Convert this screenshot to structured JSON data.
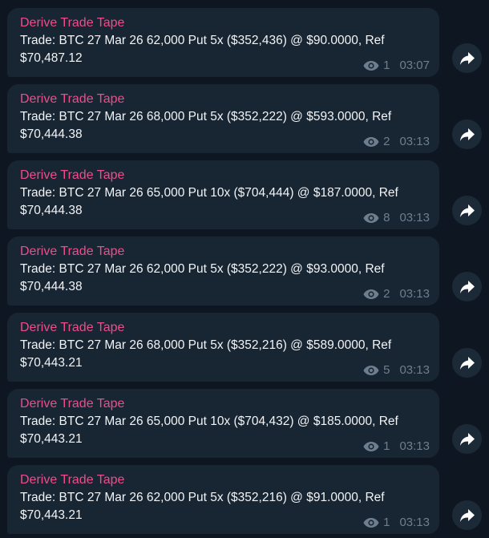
{
  "messages": [
    {
      "sender": "Derive Trade Tape",
      "text": "Trade: BTC 27 Mar 26 62,000 Put 5x ($352,436) @ $90.0000, Ref $70,487.12",
      "views": "1",
      "time": "03:07"
    },
    {
      "sender": "Derive Trade Tape",
      "text": "Trade: BTC 27 Mar 26 68,000 Put 5x ($352,222) @ $593.0000, Ref $70,444.38",
      "views": "2",
      "time": "03:13"
    },
    {
      "sender": "Derive Trade Tape",
      "text": "Trade: BTC 27 Mar 26 65,000 Put 10x ($704,444) @ $187.0000, Ref $70,444.38",
      "views": "8",
      "time": "03:13"
    },
    {
      "sender": "Derive Trade Tape",
      "text": "Trade: BTC 27 Mar 26 62,000 Put 5x ($352,222) @ $93.0000, Ref $70,444.38",
      "views": "2",
      "time": "03:13"
    },
    {
      "sender": "Derive Trade Tape",
      "text": "Trade: BTC 27 Mar 26 68,000 Put 5x ($352,216) @ $589.0000, Ref $70,443.21",
      "views": "5",
      "time": "03:13"
    },
    {
      "sender": "Derive Trade Tape",
      "text": "Trade: BTC 27 Mar 26 65,000 Put 10x ($704,432) @ $185.0000, Ref $70,443.21",
      "views": "1",
      "time": "03:13"
    },
    {
      "sender": "Derive Trade Tape",
      "text": "Trade: BTC 27 Mar 26 62,000 Put 5x ($352,216) @ $91.0000, Ref $70,443.21",
      "views": "1",
      "time": "03:13"
    }
  ],
  "icons": {
    "views": "eye-icon",
    "share": "share-arrow-icon"
  },
  "colors": {
    "background": "#0e1621",
    "bubble": "#182533",
    "sender": "#ee4d8c",
    "text": "#f2f4f6",
    "meta": "#6d7f8f",
    "share_button": "#1c2a38"
  }
}
